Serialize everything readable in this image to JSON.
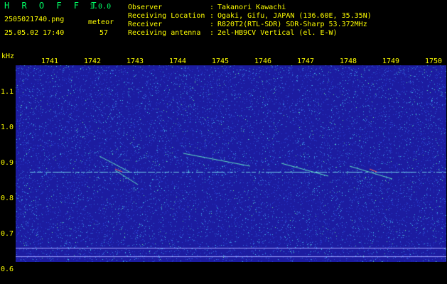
{
  "app": {
    "name": "H R O F F T",
    "version": "1.0.0"
  },
  "file": {
    "name": "2505021740.png",
    "datetime": "25.05.02 17:40"
  },
  "meteor": {
    "label": "meteor",
    "count": "57"
  },
  "info": [
    {
      "key": "Observer",
      "sep": ":",
      "value": "Takanori Kawachi"
    },
    {
      "key": "Receiving Location",
      "sep": ":",
      "value": "Ogaki, Gifu, JAPAN (136.60E, 35.35N)"
    },
    {
      "key": "Receiver",
      "sep": ":",
      "value": "R820T2(RTL-SDR) SDR-Sharp 53.372MHz"
    },
    {
      "key": "Receiving antenna",
      "sep": ":",
      "value": "2el-HB9CV Vertical (el. E-W)"
    }
  ],
  "axis": {
    "y_unit": "kHz",
    "y_ticks": [
      "1.1",
      "1.0",
      "0.9",
      "0.8",
      "0.7",
      "0.6"
    ],
    "x_ticks": [
      "1741",
      "1742",
      "1743",
      "1744",
      "1745",
      "1746",
      "1747",
      "1748",
      "1749",
      "1750"
    ]
  },
  "colors": {
    "background": "#000000",
    "text_yellow": "#ffff00",
    "text_green": "#00ff66",
    "spectrum_base": "#1c1ca0"
  }
}
